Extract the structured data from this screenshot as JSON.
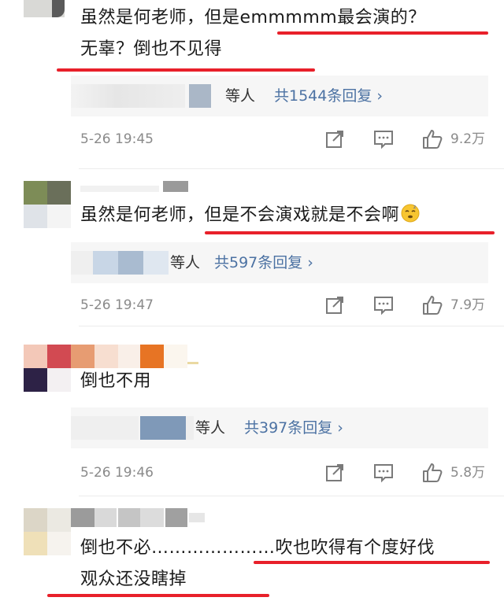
{
  "comments": [
    {
      "text_lines": [
        "虽然是何老师，但是emmmmm最会演的？",
        "无辜？倒也不见得"
      ],
      "reply_people": "等人",
      "reply_count": "共1544条回复 ›",
      "timestamp": "5-26 19:45",
      "likes": "9.2万"
    },
    {
      "text_lines": [
        "虽然是何老师，但是不会演戏就是不会啊"
      ],
      "emoji": "sleepy-face-emoji",
      "reply_people": "等人",
      "reply_count": "共597条回复 ›",
      "timestamp": "5-26 19:47",
      "likes": "7.9万"
    },
    {
      "text_lines": [
        "倒也不用"
      ],
      "reply_people": "等人",
      "reply_count": "共397条回复 ›",
      "timestamp": "5-26 19:46",
      "likes": "5.8万"
    },
    {
      "text_lines": [
        "倒也不必…………………吹也吹得有个度好伐",
        "观众还没瞎掉"
      ]
    }
  ],
  "icons": [
    "share-icon",
    "comment-icon",
    "like-icon"
  ],
  "colors": {
    "underline": "#e8202a",
    "link": "#4c72a3",
    "meta": "#8a8a8a",
    "reply_bg": "#f6f6f6"
  }
}
